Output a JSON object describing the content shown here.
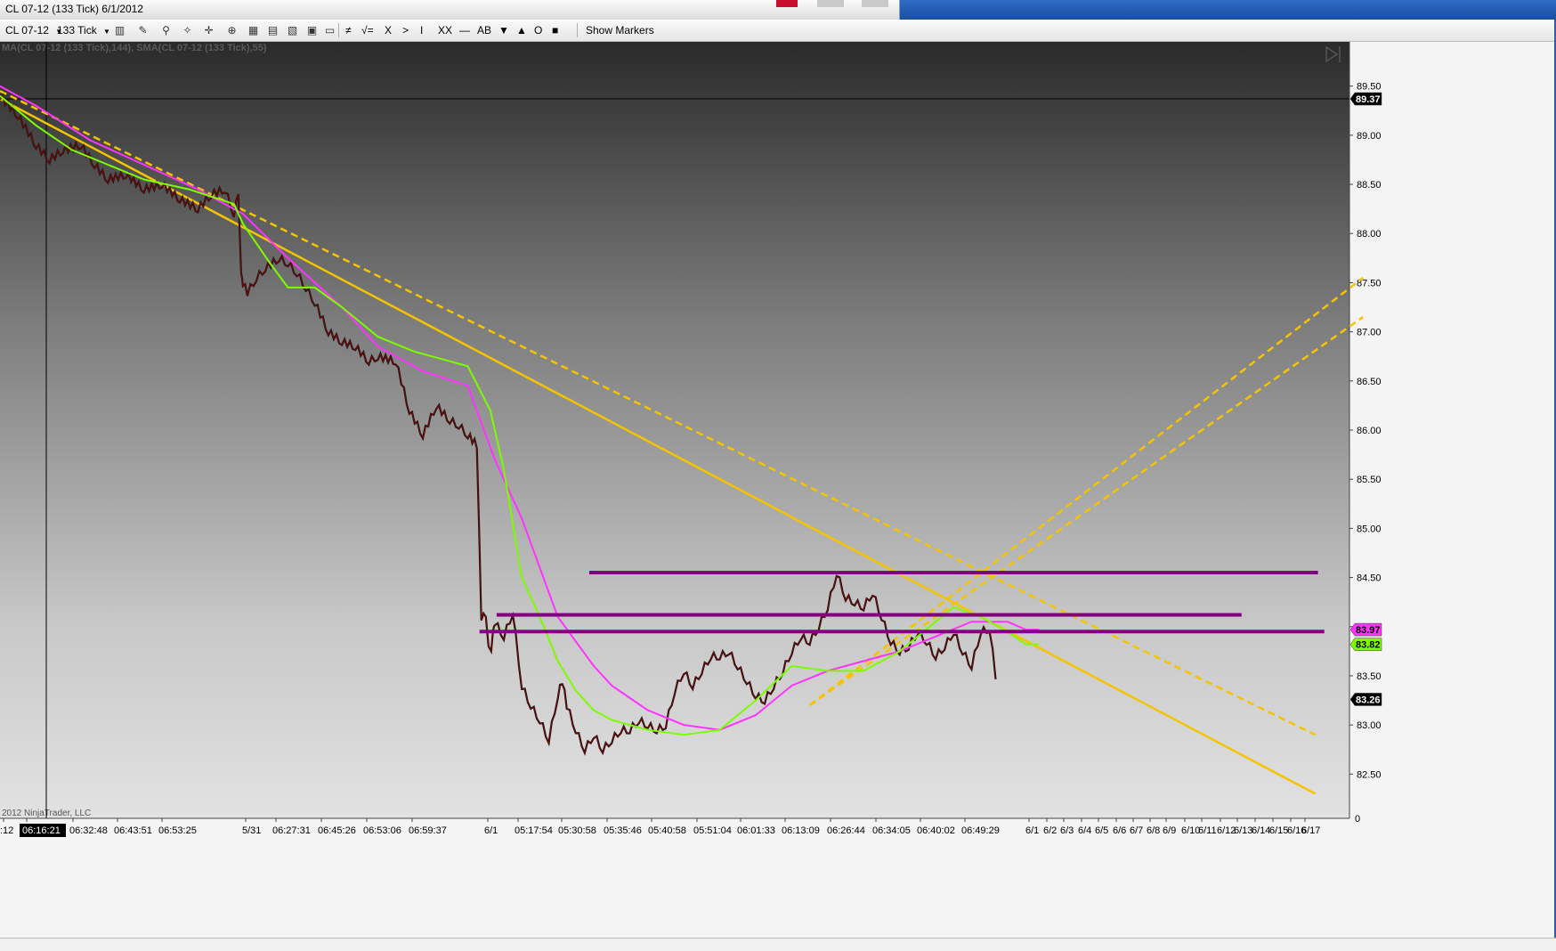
{
  "window": {
    "title": "CL 07-12 (133 Tick)  6/1/2012"
  },
  "toolbar": {
    "instrument": "CL 07-12",
    "period": "133 Tick",
    "tools": [
      {
        "name": "bar-type-icon",
        "glyph": "▥"
      },
      {
        "name": "pencil-icon",
        "glyph": "✎"
      },
      {
        "name": "pin-icon",
        "glyph": "⚲"
      },
      {
        "name": "hand-icon",
        "glyph": "✧"
      },
      {
        "name": "crosshair-icon",
        "glyph": "✛"
      },
      {
        "name": "zoom-icon",
        "glyph": "⊕"
      },
      {
        "name": "indicators-icon",
        "glyph": "▦"
      },
      {
        "name": "strategies-icon",
        "glyph": "▤"
      },
      {
        "name": "chart-style-icon",
        "glyph": "▧"
      },
      {
        "name": "properties-icon",
        "glyph": "▣"
      },
      {
        "name": "data-box-icon",
        "glyph": "▭"
      }
    ],
    "draw_tools": [
      "≠",
      "√=",
      "X",
      ">",
      "I",
      "XX",
      "—",
      "AB",
      "▼",
      "▲",
      "O",
      "■"
    ],
    "show_markers": "Show Markers"
  },
  "colors": {
    "magenta_sma": "#ff33ff",
    "green_sma": "#7cfc00",
    "trend_line": "#f5c400",
    "level_line": "#800080",
    "candle_down": "#8b0000"
  },
  "chart_data": {
    "type": "line",
    "indicator_label": "MA(CL 07-12 (133 Tick),144), SMA(CL 07-12 (133 Tick),55)",
    "copyright": "2012 NinjaTrader, LLC",
    "crosshair_time": "06:16:21",
    "crosshair_price": "89.37",
    "ylim": [
      82.05,
      89.95
    ],
    "y_ticks": [
      "89.50",
      "89.00",
      "88.50",
      "88.00",
      "87.50",
      "87.00",
      "86.50",
      "86.00",
      "85.50",
      "85.00",
      "84.50",
      "84.00",
      "83.50",
      "83.00",
      "82.50"
    ],
    "y_tick_values": [
      89.5,
      89.0,
      88.5,
      88.0,
      87.5,
      87.0,
      86.5,
      86.0,
      85.5,
      85.0,
      84.5,
      84.0,
      83.5,
      83.0,
      82.5
    ],
    "x_tick_labels": [
      ":12",
      "06:16:21",
      "06:32:48",
      "06:43:51",
      "06:53:25",
      "5/31",
      "06:27:31",
      "06:45:26",
      "06:53:06",
      "06:59:37",
      "6/1",
      "05:17:54",
      "05:30:58",
      "05:35:46",
      "05:40:58",
      "05:51:04",
      "06:01:33",
      "06:13:09",
      "06:26:44",
      "06:34:05",
      "06:40:02",
      "06:49:29",
      "6/1",
      "6/2",
      "6/3",
      "6/4",
      "6/5",
      "6/6",
      "6/7",
      "6/8",
      "6/9",
      "6/10",
      "6/11",
      "6/12",
      "6/13",
      "6/14",
      "6/15",
      "6/16",
      "6/17"
    ],
    "price_labels": [
      {
        "label": "89.37",
        "value": 89.37,
        "color": "#000000",
        "text_color": "#ffffff"
      },
      {
        "label": "83.97",
        "value": 83.97,
        "color": "#ff33ff",
        "text_color": "#000000"
      },
      {
        "label": "83.82",
        "value": 83.82,
        "color": "#7cfc00",
        "text_color": "#000000"
      },
      {
        "label": "83.26",
        "value": 83.26,
        "color": "#000000",
        "text_color": "#ffffff"
      }
    ],
    "x_domain": [
      0,
      1500
    ],
    "price_series": {
      "name": "CL 07-12 (133 Tick)",
      "x": [
        0,
        20,
        40,
        55,
        70,
        90,
        105,
        120,
        140,
        160,
        180,
        200,
        220,
        235,
        250,
        260,
        265,
        268,
        270,
        275,
        285,
        295,
        310,
        320,
        330,
        340,
        350,
        365,
        380,
        395,
        410,
        420,
        440,
        455,
        470,
        485,
        500,
        510,
        520,
        525,
        530,
        535,
        540,
        543,
        546,
        548,
        550,
        560,
        570,
        580,
        590,
        600,
        610,
        620,
        625,
        630,
        640,
        650,
        660,
        670,
        680,
        690,
        700,
        710,
        720,
        730,
        740,
        750,
        760,
        770,
        780,
        790,
        800,
        810,
        820,
        830,
        840,
        850,
        860,
        870,
        880,
        890,
        900,
        910,
        920,
        930,
        940,
        950,
        960,
        970,
        980,
        990,
        1000,
        1010,
        1020,
        1030,
        1040,
        1050,
        1060,
        1070,
        1080,
        1090,
        1100,
        1110,
        1120,
        1130,
        1140,
        1150,
        1152,
        1155
      ],
      "y": [
        89.4,
        89.2,
        88.9,
        88.75,
        88.85,
        88.9,
        88.7,
        88.55,
        88.6,
        88.45,
        88.5,
        88.35,
        88.25,
        88.4,
        88.45,
        88.2,
        88.4,
        87.6,
        87.5,
        87.4,
        87.55,
        87.65,
        87.75,
        87.7,
        87.6,
        87.45,
        87.3,
        87.0,
        86.9,
        86.85,
        86.7,
        86.75,
        86.7,
        86.2,
        85.95,
        86.25,
        86.1,
        86.05,
        85.95,
        85.9,
        85.85,
        84.1,
        84.1,
        83.8,
        83.75,
        83.95,
        84.05,
        83.9,
        84.15,
        83.4,
        83.2,
        83.05,
        82.85,
        83.3,
        83.45,
        83.2,
        82.95,
        82.75,
        82.9,
        82.75,
        82.85,
        82.95,
        82.95,
        83.05,
        83.0,
        82.95,
        83.0,
        83.35,
        83.55,
        83.4,
        83.55,
        83.7,
        83.7,
        83.75,
        83.6,
        83.45,
        83.3,
        83.25,
        83.4,
        83.55,
        83.75,
        83.9,
        83.85,
        84.0,
        84.2,
        84.55,
        84.3,
        84.25,
        84.2,
        84.35,
        84.1,
        83.85,
        83.75,
        83.8,
        83.95,
        83.85,
        83.7,
        83.8,
        83.95,
        83.75,
        83.6,
        83.95,
        83.98,
        83.26
      ]
    },
    "series": [
      {
        "name": "SMA(CL 07-12 (133 Tick),144)",
        "color": "#ff33ff",
        "x": [
          0,
          40,
          100,
          160,
          220,
          270,
          320,
          380,
          420,
          470,
          520,
          550,
          580,
          620,
          660,
          680,
          720,
          760,
          800,
          840,
          880,
          920,
          960,
          1000,
          1040,
          1080,
          1120,
          1140,
          1155
        ],
        "y": [
          89.5,
          89.3,
          88.95,
          88.7,
          88.45,
          88.2,
          87.75,
          87.25,
          86.85,
          86.6,
          86.45,
          85.7,
          85.1,
          84.1,
          83.6,
          83.4,
          83.15,
          83.0,
          82.95,
          83.1,
          83.4,
          83.55,
          83.65,
          83.75,
          83.9,
          84.05,
          84.05,
          83.97,
          83.97
        ]
      },
      {
        "name": "SMA(CL 07-12 (133 Tick),55)",
        "color": "#7cfc00",
        "x": [
          0,
          40,
          80,
          120,
          160,
          210,
          260,
          270,
          300,
          320,
          350,
          380,
          420,
          460,
          500,
          520,
          545,
          560,
          580,
          600,
          620,
          640,
          660,
          680,
          700,
          720,
          760,
          800,
          840,
          880,
          920,
          960,
          1000,
          1040,
          1060,
          1090,
          1120,
          1140,
          1155
        ],
        "y": [
          89.4,
          89.1,
          88.85,
          88.7,
          88.55,
          88.45,
          88.3,
          88.1,
          87.7,
          87.45,
          87.45,
          87.25,
          86.95,
          86.8,
          86.7,
          86.65,
          86.2,
          85.6,
          84.5,
          84.1,
          83.65,
          83.35,
          83.15,
          83.05,
          83.0,
          82.95,
          82.9,
          82.95,
          83.25,
          83.6,
          83.55,
          83.55,
          83.75,
          84.05,
          84.2,
          84.1,
          83.95,
          83.82,
          83.82
        ]
      }
    ],
    "trend_lines": [
      {
        "x1": 0,
        "y1": 89.45,
        "x2": 1462,
        "y2": 82.9,
        "dashed": true
      },
      {
        "x1": 0,
        "y1": 89.37,
        "x2": 1462,
        "y2": 82.3,
        "dashed": false
      },
      {
        "x1": 900,
        "y1": 83.2,
        "x2": 1515,
        "y2": 87.55,
        "dashed": true
      },
      {
        "x1": 900,
        "y1": 83.2,
        "x2": 1515,
        "y2": 87.15,
        "dashed": true
      }
    ],
    "horizontal_levels": [
      {
        "value": 84.55,
        "x1": 655,
        "x2": 1465
      },
      {
        "value": 84.12,
        "x1": 552,
        "x2": 1380
      },
      {
        "value": 83.95,
        "x1": 533,
        "x2": 1472
      }
    ]
  }
}
